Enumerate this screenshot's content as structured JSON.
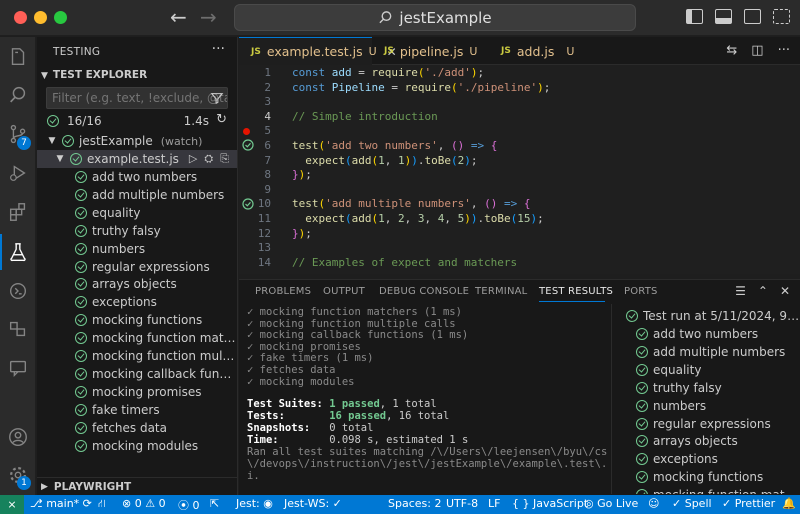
{
  "title_bar": {
    "search_text": "jestExample",
    "back_glyph": "←",
    "forward_glyph": "→",
    "colors": {
      "close": "#ff5f57",
      "minimize": "#febc2e",
      "maximize": "#28c840"
    }
  },
  "activity_bar": {
    "items": [
      {
        "name": "explorer-icon"
      },
      {
        "name": "search-icon"
      },
      {
        "name": "source-control-icon",
        "badge": "7"
      },
      {
        "name": "run-debug-icon"
      },
      {
        "name": "extensions-icon"
      },
      {
        "name": "testing-icon",
        "active": true
      },
      {
        "name": "remote-explorer-icon"
      },
      {
        "name": "containers-icon"
      },
      {
        "name": "chat-icon"
      },
      {
        "name": "accounts-icon"
      },
      {
        "name": "manage-gear-icon",
        "badge": "1"
      }
    ]
  },
  "sidebar": {
    "title": "TESTING",
    "more": "···",
    "section_title": "TEST EXPLORER",
    "filter_placeholder": "Filter (e.g. text, !exclude, @tag)",
    "summary": {
      "count": "16/16",
      "duration": "1.4s"
    },
    "root": {
      "label": "jestExample",
      "sub": "(watch)"
    },
    "file": {
      "label": "example.test.js"
    },
    "tests": [
      "add two numbers",
      "add multiple numbers",
      "equality",
      "truthy falsy",
      "numbers",
      "regular expressions",
      "arrays objects",
      "exceptions",
      "mocking functions",
      "mocking function matchers",
      "mocking function multiple c...",
      "mocking callback functions",
      "mocking promises",
      "fake timers",
      "fetches data",
      "mocking modules"
    ],
    "playwright_title": "PLAYWRIGHT"
  },
  "editor": {
    "tabs": [
      {
        "label": "example.test.js",
        "mod": "U",
        "active": true
      },
      {
        "label": "pipeline.js",
        "mod": "U"
      },
      {
        "label": "add.js",
        "mod": "U"
      }
    ],
    "line_numbers": [
      "1",
      "2",
      "3",
      "4",
      "5",
      "6",
      "7",
      "8",
      "9",
      "10",
      "11",
      "12",
      "13",
      "14"
    ]
  },
  "panel": {
    "tabs": [
      "PROBLEMS",
      "OUTPUT",
      "DEBUG CONSOLE",
      "TERMINAL",
      "TEST RESULTS",
      "PORTS"
    ],
    "active_tab": "TEST RESULTS",
    "pass_lines": [
      "✓ mocking function matchers (1 ms)",
      "✓ mocking function multiple calls",
      "✓ mocking callback functions (1 ms)",
      "✓ mocking promises",
      "✓ fake timers (1 ms)",
      "✓ fetches data",
      "✓ mocking modules"
    ],
    "summary": {
      "suites_label": "Test Suites:",
      "suites_passed": "1 passed",
      "suites_rest": ", 1 total",
      "tests_label": "Tests:",
      "tests_passed": "16 passed",
      "tests_rest": ", 16 total",
      "snapshots_label": "Snapshots:",
      "snapshots_value": "0 total",
      "time_label": "Time:",
      "time_value": "0.098 s, estimated 1 s",
      "ran_lines": [
        "Ran all test suites matching /\\/Users\\/leejensen\\/byu\\/cs329",
        "\\/devops\\/instruction\\/jest\\/jestExample\\/example\\.test\\.js/",
        "i."
      ]
    },
    "results_header": "Test run at 5/11/2024, 9:52:...",
    "results": [
      "add two numbers",
      "add multiple numbers",
      "equality",
      "truthy falsy",
      "numbers",
      "regular expressions",
      "arrays objects",
      "exceptions",
      "mocking functions",
      "mocking function matchers"
    ]
  },
  "status_bar": {
    "branch": "main*",
    "errors": "0",
    "warnings": "0",
    "ports": "0",
    "jest": "Jest:",
    "jest_ws": "Jest-WS: ✓",
    "spaces": "Spaces: 2",
    "encoding": "UTF-8",
    "eol": "LF",
    "language": "{ } JavaScript",
    "golive": "Go Live",
    "spell": "✓ Spell",
    "prettier": "✓ Prettier"
  }
}
